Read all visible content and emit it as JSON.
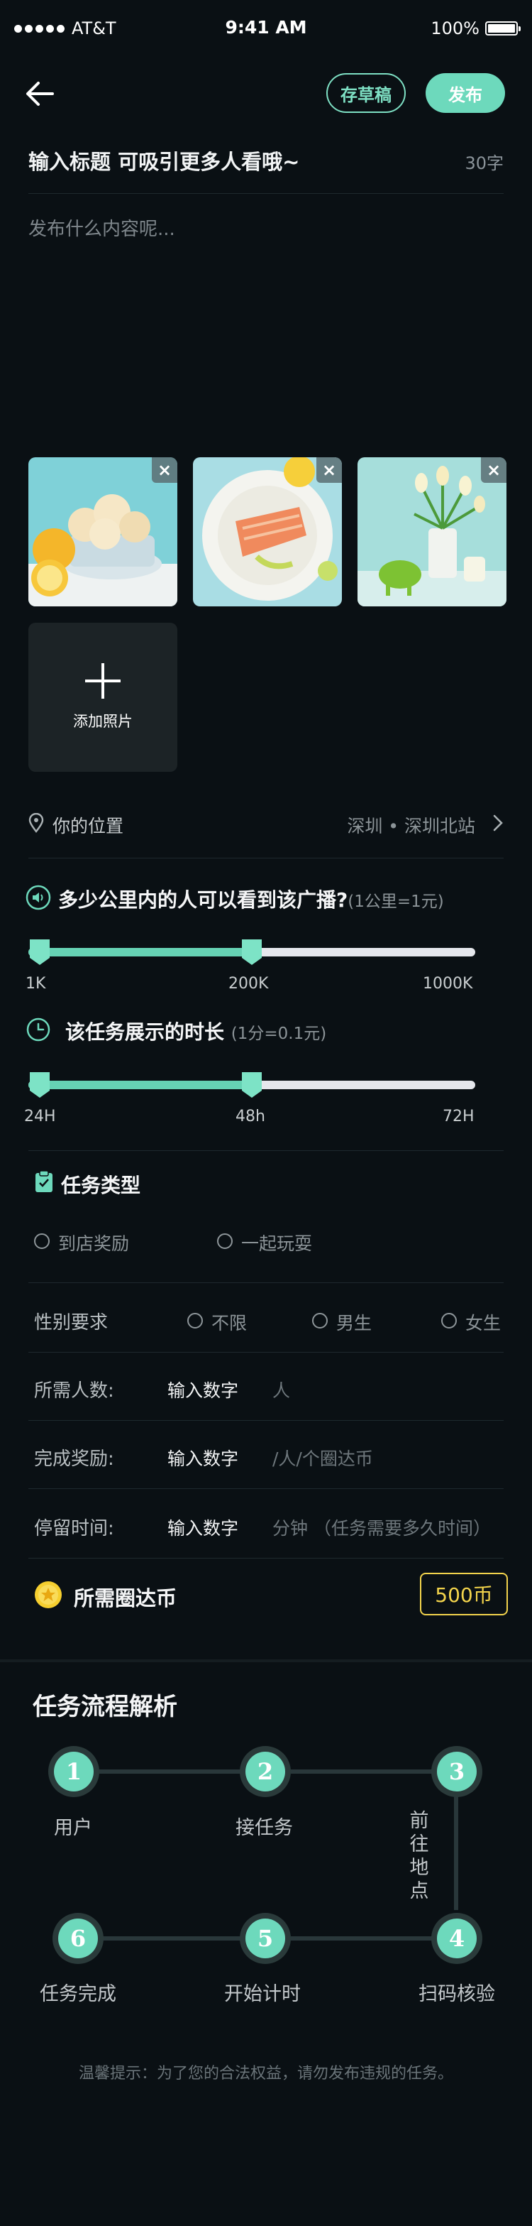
{
  "status_bar": {
    "carrier": "AT&T",
    "time": "9:41 AM",
    "battery": "100%"
  },
  "nav": {
    "draft_label": "存草稿",
    "publish_label": "发布"
  },
  "title_input": {
    "placeholder": "输入标题 可吸引更多人看哦~",
    "counter": "30字"
  },
  "content_input": {
    "placeholder": "发布什么内容呢..."
  },
  "photos": [
    {
      "name": "lemon-bun-photo",
      "close": "×"
    },
    {
      "name": "salmon-plate-photo",
      "close": "×"
    },
    {
      "name": "tulip-vase-photo",
      "close": "×"
    }
  ],
  "add_photo": {
    "label": "添加照片"
  },
  "location": {
    "label": "你的位置",
    "value": "深圳 • 深圳北站"
  },
  "broadcast": {
    "title": "多少公里内的人可以看到该广播?",
    "note": "(1公里=1元)",
    "ticks": [
      "1K",
      "200K",
      "1000K"
    ],
    "selected_range": [
      0,
      0.5
    ]
  },
  "duration": {
    "title": "该任务展示的时长",
    "note": "(1分=0.1元)",
    "ticks": [
      "24H",
      "48h",
      "72H"
    ],
    "selected_range": [
      0,
      0.5
    ]
  },
  "task_type": {
    "title": "任务类型",
    "options": [
      "到店奖励",
      "一起玩耍"
    ]
  },
  "gender": {
    "label": "性别要求",
    "options": [
      "不限",
      "男生",
      "女生"
    ]
  },
  "rows": {
    "people": {
      "label": "所需人数:",
      "input": "输入数字",
      "unit": "人"
    },
    "reward": {
      "label": "完成奖励:",
      "input": "输入数字",
      "unit": "/人/个圈达币"
    },
    "stay": {
      "label": "停留时间:",
      "input": "输入数字",
      "unit": "分钟 （任务需要多久时间）"
    }
  },
  "coins": {
    "label": "所需圈达币",
    "value": "500币"
  },
  "flow": {
    "title": "任务流程解析",
    "steps": [
      {
        "num": "1",
        "label": "用户"
      },
      {
        "num": "2",
        "label": "接任务"
      },
      {
        "num": "3",
        "label": "前往地点"
      },
      {
        "num": "4",
        "label": "扫码核验"
      },
      {
        "num": "5",
        "label": "开始计时"
      },
      {
        "num": "6",
        "label": "任务完成"
      }
    ]
  },
  "tip": "温馨提示：为了您的合法权益，请勿发布违规的任务。",
  "colors": {
    "accent": "#6dd9bc",
    "background": "#0a1014",
    "coin": "#f3d44c"
  }
}
